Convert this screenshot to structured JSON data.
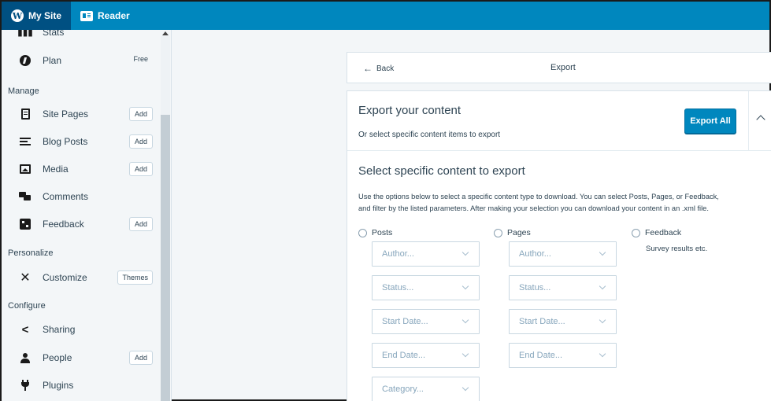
{
  "masterbar": {
    "my_site": "My Site",
    "reader": "Reader"
  },
  "sidebar": {
    "partial_item": "Stats",
    "plan": {
      "label": "Plan",
      "badge": "Free"
    },
    "manage_heading": "Manage",
    "items": [
      {
        "label": "Site Pages",
        "button": "Add"
      },
      {
        "label": "Blog Posts",
        "button": "Add"
      },
      {
        "label": "Media",
        "button": "Add"
      },
      {
        "label": "Comments"
      },
      {
        "label": "Feedback",
        "button": "Add"
      }
    ],
    "personalize_heading": "Personalize",
    "customize": {
      "label": "Customize",
      "button": "Themes"
    },
    "configure_heading": "Configure",
    "config_items": [
      {
        "label": "Sharing"
      },
      {
        "label": "People",
        "button": "Add"
      },
      {
        "label": "Plugins"
      }
    ]
  },
  "header": {
    "back": "Back",
    "title": "Export"
  },
  "export": {
    "title": "Export your content",
    "subtitle": "Or select specific content items to export",
    "export_all": "Export All",
    "select_title": "Select specific content to export",
    "description_line1": "Use the options below to select a specific content type to download. You can select Posts, Pages, or Feedback,",
    "description_line2": "and filter by the listed parameters. After making your selection you can download your content in an .xml file.",
    "posts": {
      "label": "Posts",
      "author": "Author...",
      "status": "Status...",
      "start_date": "Start Date...",
      "end_date": "End Date...",
      "category": "Category..."
    },
    "pages": {
      "label": "Pages",
      "author": "Author...",
      "status": "Status...",
      "start_date": "Start Date...",
      "end_date": "End Date..."
    },
    "feedback": {
      "label": "Feedback",
      "note": "Survey results etc."
    }
  },
  "colors": {
    "masterbar": "#0087be",
    "masterbar_active": "#005082",
    "primary_button": "#0087be"
  }
}
